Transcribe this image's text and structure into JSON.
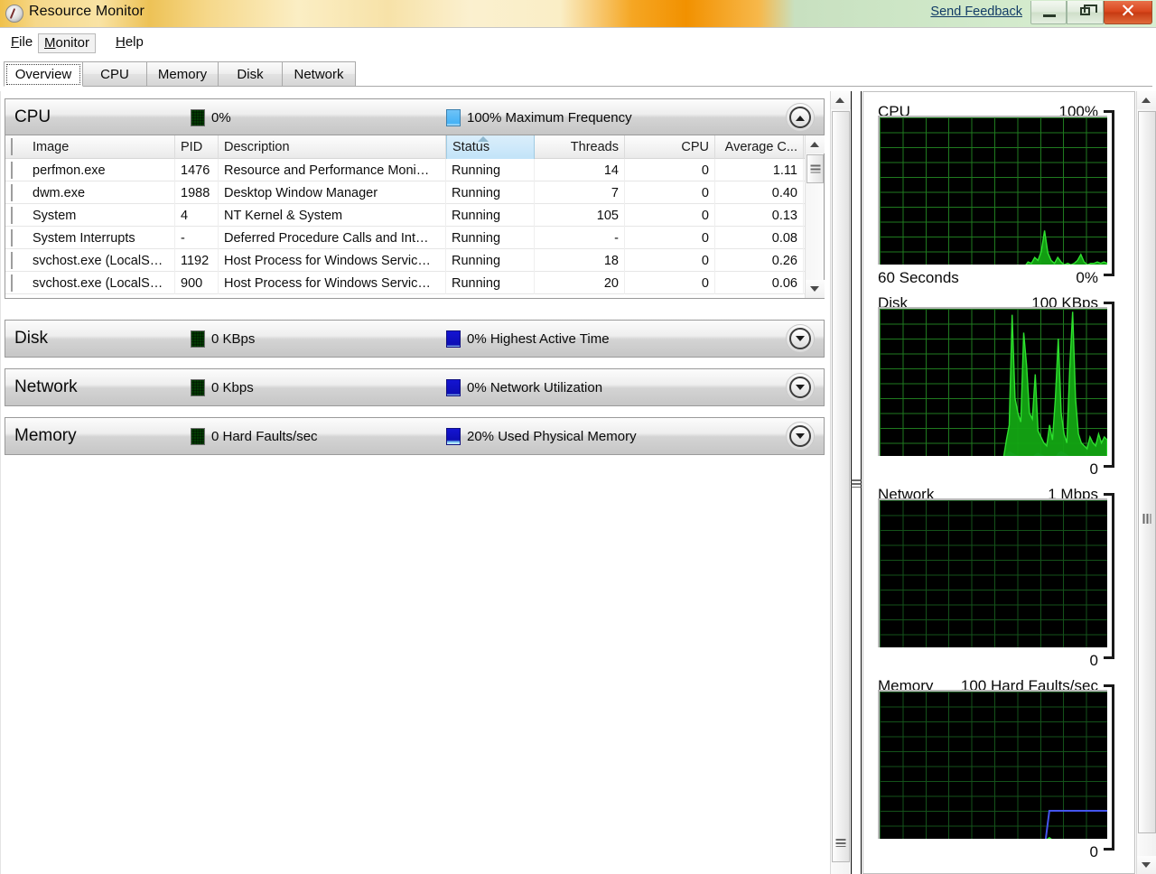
{
  "window": {
    "title": "Resource Monitor",
    "app_icon": "resource-monitor-icon",
    "send_feedback": "Send Feedback",
    "minimize": "minimize-icon",
    "maximize": "restore-icon",
    "close": "close-icon"
  },
  "menu": [
    {
      "label": "File",
      "accel": "F"
    },
    {
      "label": "Monitor",
      "accel": "M"
    },
    {
      "label": "Help",
      "accel": "H"
    }
  ],
  "tabs": [
    {
      "label": "Overview",
      "active": true
    },
    {
      "label": "CPU",
      "active": false
    },
    {
      "label": "Memory",
      "active": false
    },
    {
      "label": "Disk",
      "active": false
    },
    {
      "label": "Network",
      "active": false
    }
  ],
  "sections": [
    {
      "id": "cpu",
      "title": "CPU",
      "stat1_icon": "green-grid-chip",
      "stat1": "0%",
      "stat2_icon": "light-blue-chip",
      "stat2": "100% Maximum Frequency",
      "chevron": "chevron-up-icon",
      "expanded": true
    },
    {
      "id": "disk",
      "title": "Disk",
      "stat1_icon": "green-grid-chip",
      "stat1": "0 KBps",
      "stat2_icon": "blue-chip",
      "stat2": "0% Highest Active Time",
      "chevron": "chevron-down-icon",
      "expanded": false
    },
    {
      "id": "network",
      "title": "Network",
      "stat1_icon": "green-grid-chip",
      "stat1": "0 Kbps",
      "stat2_icon": "blue-chip",
      "stat2": "0% Network Utilization",
      "chevron": "chevron-down-icon",
      "expanded": false
    },
    {
      "id": "memory",
      "title": "Memory",
      "stat1_icon": "green-grid-chip",
      "stat1": "0 Hard Faults/sec",
      "stat2_icon": "blue-chip",
      "stat2": "20% Used Physical Memory",
      "chevron": "chevron-down-icon",
      "expanded": false
    }
  ],
  "process_table": {
    "columns": [
      {
        "label": "Image",
        "align": "left"
      },
      {
        "label": "PID",
        "align": "left"
      },
      {
        "label": "Description",
        "align": "left"
      },
      {
        "label": "Status",
        "align": "left",
        "sorted": "ascending"
      },
      {
        "label": "Threads",
        "align": "right"
      },
      {
        "label": "CPU",
        "align": "right"
      },
      {
        "label": "Average C...",
        "align": "right"
      }
    ],
    "rows": [
      {
        "image": "perfmon.exe",
        "pid": "1476",
        "description": "Resource and Performance Moni…",
        "status": "Running",
        "threads": "14",
        "cpu": "0",
        "average_cpu": "1.11"
      },
      {
        "image": "dwm.exe",
        "pid": "1988",
        "description": "Desktop Window Manager",
        "status": "Running",
        "threads": "7",
        "cpu": "0",
        "average_cpu": "0.40"
      },
      {
        "image": "System",
        "pid": "4",
        "description": "NT Kernel & System",
        "status": "Running",
        "threads": "105",
        "cpu": "0",
        "average_cpu": "0.13"
      },
      {
        "image": "System Interrupts",
        "pid": "-",
        "description": "Deferred Procedure Calls and Int…",
        "status": "Running",
        "threads": "-",
        "cpu": "0",
        "average_cpu": "0.08"
      },
      {
        "image": "svchost.exe (LocalS…",
        "pid": "1192",
        "description": "Host Process for Windows Servic…",
        "status": "Running",
        "threads": "18",
        "cpu": "0",
        "average_cpu": "0.26"
      },
      {
        "image": "svchost.exe (LocalS…",
        "pid": "900",
        "description": "Host Process for Windows Servic…",
        "status": "Running",
        "threads": "20",
        "cpu": "0",
        "average_cpu": "0.06"
      }
    ]
  },
  "chart_data": [
    {
      "id": "cpu-graph",
      "type": "area",
      "title": "CPU",
      "ymax_label": "100%",
      "ymin_label": "0%",
      "xlabel": "60 Seconds",
      "ylim": [
        0,
        100
      ],
      "grid": true,
      "series": [
        {
          "name": "CPU Usage",
          "color": "#2ee02e",
          "values": [
            0,
            0,
            0,
            0,
            0,
            0,
            0,
            0,
            0,
            0,
            0,
            0,
            0,
            0,
            0,
            0,
            0,
            0,
            0,
            0,
            0,
            0,
            0,
            0,
            0,
            0,
            0,
            0,
            0,
            0,
            0,
            0,
            0,
            0,
            0,
            0,
            0,
            0,
            0,
            0,
            0,
            0,
            0,
            0,
            0,
            3,
            2,
            6,
            4,
            10,
            24,
            9,
            4,
            2,
            6,
            3,
            1,
            2,
            1,
            2,
            4,
            8,
            3,
            1,
            2,
            2,
            3,
            2,
            3,
            2
          ]
        }
      ]
    },
    {
      "id": "disk-graph",
      "type": "area",
      "title": "Disk",
      "ymax_label": "100 KBps",
      "ymin_label": "0",
      "ylim": [
        0,
        100
      ],
      "grid": true,
      "series": [
        {
          "name": "Disk Transfer",
          "color": "#2ee02e",
          "values": [
            0,
            0,
            0,
            0,
            0,
            0,
            0,
            0,
            0,
            0,
            0,
            0,
            0,
            0,
            0,
            0,
            0,
            0,
            0,
            0,
            0,
            0,
            0,
            0,
            0,
            0,
            0,
            0,
            0,
            0,
            0,
            0,
            0,
            0,
            0,
            0,
            0,
            0,
            0,
            0,
            0,
            0,
            0,
            0,
            12,
            22,
            96,
            40,
            30,
            24,
            84,
            62,
            30,
            26,
            56,
            18,
            14,
            10,
            8,
            22,
            12,
            40,
            80,
            30,
            16,
            10,
            60,
            98,
            40,
            16,
            10,
            8,
            6,
            14,
            10,
            8,
            16,
            10,
            14,
            12
          ]
        },
        {
          "name": "Highest Active Time",
          "color": "#3a4ed0",
          "values": [
            0,
            0,
            0,
            0,
            0,
            0,
            0,
            0,
            0,
            0,
            0,
            0,
            0,
            0,
            0,
            0,
            0,
            0,
            0,
            0,
            0,
            0,
            0,
            0,
            0,
            0,
            0,
            0,
            0,
            0,
            0,
            0,
            0,
            0,
            0,
            0,
            0,
            0,
            0,
            0,
            0,
            0,
            0,
            0,
            2,
            4,
            3,
            2,
            1,
            0,
            0,
            0,
            0,
            0,
            2,
            3,
            2,
            1,
            0,
            0,
            0,
            0,
            3,
            4,
            3,
            2,
            0,
            0,
            0,
            0,
            0,
            0,
            0,
            0,
            0,
            0,
            0,
            0,
            0,
            0
          ]
        }
      ]
    },
    {
      "id": "network-graph",
      "type": "area",
      "title": "Network",
      "ymax_label": "1 Mbps",
      "ymin_label": "0",
      "ylim": [
        0,
        1
      ],
      "grid": true,
      "series": [
        {
          "name": "Network Traffic",
          "color": "#2ee02e",
          "values": [
            0,
            0,
            0,
            0,
            0,
            0,
            0,
            0,
            0,
            0,
            0,
            0,
            0,
            0,
            0,
            0,
            0,
            0,
            0,
            0,
            0,
            0,
            0,
            0,
            0,
            0,
            0,
            0,
            0,
            0,
            0,
            0,
            0,
            0,
            0,
            0,
            0,
            0,
            0,
            0,
            0,
            0,
            0,
            0,
            0,
            0,
            0,
            0,
            0,
            0,
            0,
            0,
            0,
            0,
            0,
            0,
            0,
            0,
            0,
            0
          ]
        }
      ]
    },
    {
      "id": "memory-graph",
      "type": "line",
      "title": "Memory",
      "ymax_label": "100 Hard Faults/sec",
      "ymin_label": "0",
      "ylim": [
        0,
        100
      ],
      "grid": true,
      "series": [
        {
          "name": "Hard Faults/sec",
          "color": "#2ee02e",
          "values": [
            0,
            0,
            0,
            0,
            0,
            0,
            0,
            0,
            0,
            0,
            0,
            0,
            0,
            0,
            0,
            0,
            0,
            0,
            0,
            0,
            0,
            0,
            0,
            0,
            0,
            0,
            0,
            0,
            0,
            0,
            0,
            0,
            0,
            0,
            0,
            0,
            0,
            0,
            0,
            0,
            0,
            0,
            0,
            0,
            2,
            0,
            0,
            0,
            0,
            0,
            0,
            0,
            0,
            0,
            0,
            0,
            0,
            0,
            0,
            0
          ]
        },
        {
          "name": "Used Physical Memory",
          "color": "#4455ee",
          "values": [
            0,
            0,
            0,
            0,
            0,
            0,
            0,
            0,
            0,
            0,
            0,
            0,
            0,
            0,
            0,
            0,
            0,
            0,
            0,
            0,
            0,
            0,
            0,
            0,
            0,
            0,
            0,
            0,
            0,
            0,
            0,
            0,
            0,
            0,
            0,
            0,
            0,
            0,
            0,
            0,
            0,
            0,
            0,
            0,
            20,
            20,
            20,
            20,
            20,
            20,
            20,
            20,
            20,
            20,
            20,
            20,
            20,
            20,
            20,
            20
          ]
        }
      ]
    }
  ],
  "scrollbars": {
    "table": {
      "up": "scroll-up-arrow",
      "down": "scroll-down-arrow",
      "thumb": "scroll-thumb"
    },
    "main": {
      "up": "scroll-up-arrow",
      "down": "scroll-down-arrow",
      "thumb": "scroll-thumb"
    },
    "right": {
      "up": "scroll-up-arrow",
      "down": "scroll-down-arrow",
      "thumb": "scroll-thumb"
    }
  },
  "splitter": {
    "name": "panel-splitter",
    "grip": "splitter-grip"
  }
}
